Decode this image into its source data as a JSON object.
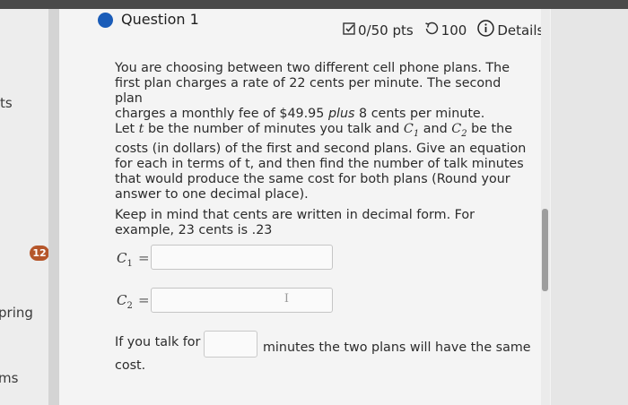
{
  "left_nav": {
    "items": [
      "ts",
      "pring",
      "ms"
    ],
    "badge": "12"
  },
  "question": {
    "title": "Question 1",
    "score": "0/50 pts",
    "attempts": "100",
    "details_label": "Details",
    "body_lines": [
      "You are choosing between two different cell phone plans. The",
      "first plan charges a rate of 22 cents per minute. The second plan",
      "charges a monthly fee of $49.95",
      "plus",
      "8 cents per minute.",
      "Let",
      "t",
      "be the number of minutes you talk and",
      "and",
      "be the",
      "costs (in dollars) of the first and second plans. Give an equation",
      "for each in terms of t, and then find the number of talk minutes",
      "that would produce the same cost for both plans (Round your",
      "answer to one decimal place)."
    ],
    "note_line1": "Keep in mind that cents are written in decimal form. For",
    "note_line2": "example, 23 cents is .23",
    "c1_label": "C",
    "c1_sub": "1",
    "c2_label": "C",
    "c2_sub": "2",
    "equals": "=",
    "cursor_glyph": "I",
    "sentence_prefix": "If you talk for",
    "sentence_suffix": "minutes the two plans will have the same",
    "sentence_end": "cost."
  },
  "colors": {
    "accent": "#1a5cb8",
    "badge": "#b5562a"
  }
}
